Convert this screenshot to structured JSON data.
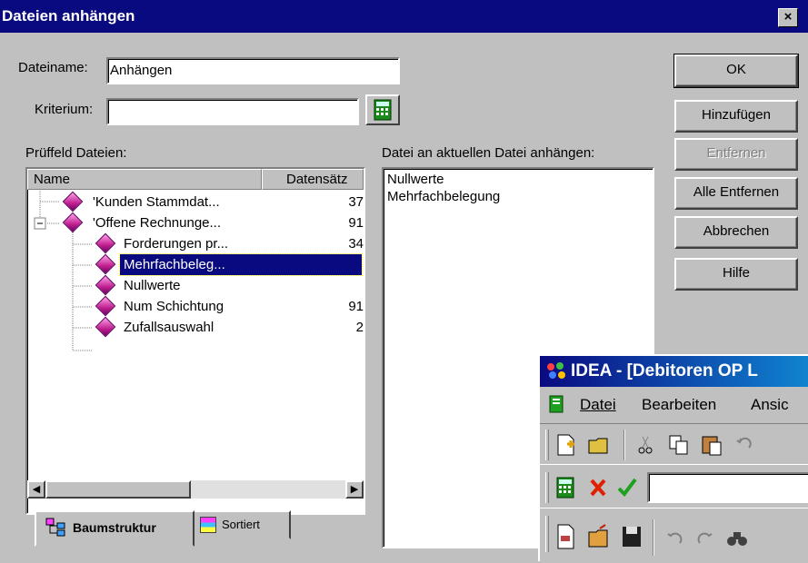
{
  "dialog": {
    "title": "Dateien anhängen",
    "close_glyph": "×"
  },
  "form": {
    "dateiname_label": "Dateiname:",
    "dateiname_value": "Anhängen",
    "kriterium_label": "Kriterium:",
    "kriterium_value": ""
  },
  "left_panel": {
    "heading": "Prüffeld Dateien:",
    "columns": [
      "Name",
      "Datensätz"
    ],
    "rows": [
      {
        "name": "'Kunden Stammdat...",
        "count": "37"
      },
      {
        "name": "'Offene Rechnunge...",
        "count": "91"
      },
      {
        "name": "Forderungen pr...",
        "count": "34"
      },
      {
        "name": "Mehrfachbeleg...",
        "count": ""
      },
      {
        "name": "Nullwerte",
        "count": ""
      },
      {
        "name": "Num Schichtung",
        "count": "91"
      },
      {
        "name": "Zufallsauswahl",
        "count": "2"
      }
    ],
    "tabs": [
      "Baumstruktur",
      "Sortiert"
    ]
  },
  "right_panel": {
    "heading": "Datei an aktuellen Datei anhängen:",
    "items": [
      "Nullwerte",
      "Mehrfachbelegung"
    ]
  },
  "buttons": {
    "ok": "OK",
    "hinzufuegen": "Hinzufügen",
    "entfernen": "Entfernen",
    "alle_entfernen": "Alle Entfernen",
    "abbrechen": "Abbrechen",
    "hilfe": "Hilfe"
  },
  "idea_window": {
    "title": "IDEA - [Debitoren OP L",
    "menu": [
      "Datei",
      "Bearbeiten",
      "Ansic"
    ]
  },
  "colors": {
    "titlebar": "#0a0a80",
    "face": "#c0c0c0",
    "selection": "#0a0a80"
  }
}
